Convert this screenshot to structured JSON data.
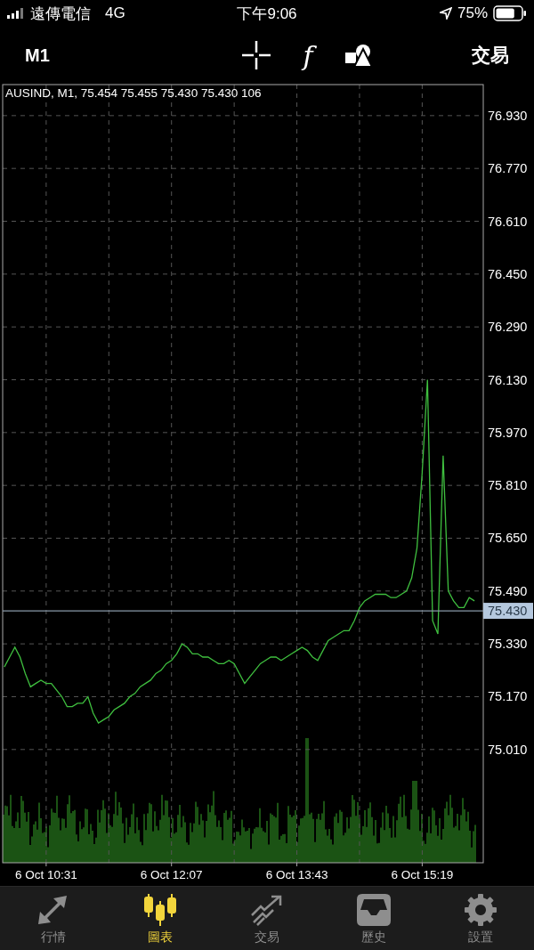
{
  "status_bar": {
    "carrier": "遠傳電信",
    "network": "4G",
    "time": "下午9:06",
    "battery": "75%"
  },
  "toolbar": {
    "timeframe": "M1",
    "indicator_symbol": "f",
    "action": "交易"
  },
  "chart": {
    "header": "AUSIND, M1, 75.454 75.455 75.430 75.430 106",
    "chart_data": {
      "type": "line",
      "categories": [
        null,
        null,
        null,
        null,
        null,
        null,
        null,
        null,
        "6 Oct 10:31",
        null,
        null,
        null,
        null,
        null,
        null,
        null,
        null,
        null,
        null,
        null,
        null,
        null,
        null,
        null,
        null,
        null,
        null,
        null,
        null,
        null,
        null,
        null,
        "6 Oct 12:07",
        null,
        null,
        null,
        null,
        null,
        null,
        null,
        null,
        null,
        null,
        null,
        null,
        null,
        null,
        null,
        null,
        null,
        null,
        null,
        null,
        null,
        null,
        null,
        "6 Oct 13:43",
        null,
        null,
        null,
        null,
        null,
        null,
        null,
        null,
        null,
        null,
        null,
        null,
        null,
        null,
        null,
        null,
        null,
        null,
        null,
        null,
        null,
        null,
        null,
        "6 Oct 15:19",
        null,
        null,
        null,
        null,
        null,
        null,
        null,
        null,
        null,
        null
      ],
      "series": [
        {
          "color": "#3fbf3f",
          "values": [
            75.26,
            75.29,
            75.32,
            75.29,
            75.24,
            75.2,
            75.21,
            75.22,
            75.21,
            75.21,
            75.19,
            75.17,
            75.14,
            75.14,
            75.15,
            75.15,
            75.17,
            75.12,
            75.09,
            75.1,
            75.11,
            75.13,
            75.14,
            75.15,
            75.17,
            75.18,
            75.2,
            75.21,
            75.22,
            75.24,
            75.25,
            75.27,
            75.28,
            75.3,
            75.33,
            75.32,
            75.3,
            75.3,
            75.29,
            75.29,
            75.28,
            75.27,
            75.27,
            75.28,
            75.27,
            75.24,
            75.21,
            75.23,
            75.25,
            75.27,
            75.28,
            75.29,
            75.29,
            75.28,
            75.29,
            75.3,
            75.31,
            75.32,
            75.31,
            75.29,
            75.28,
            75.31,
            75.34,
            75.35,
            75.36,
            75.37,
            75.37,
            75.4,
            75.44,
            75.46,
            75.47,
            75.48,
            75.48,
            75.48,
            75.47,
            75.47,
            75.48,
            75.49,
            75.53,
            75.62,
            75.85,
            76.13,
            75.4,
            75.36,
            75.9,
            75.49,
            75.46,
            75.44,
            75.44,
            75.47,
            75.46
          ]
        }
      ],
      "ylim": [
        74.667,
        77.024
      ],
      "grid": true,
      "yticks": [
        {
          "value": 76.93,
          "label": "76.930"
        },
        {
          "value": 76.77,
          "label": "76.770"
        },
        {
          "value": 76.61,
          "label": "76.610"
        },
        {
          "value": 76.45,
          "label": "76.450"
        },
        {
          "value": 76.29,
          "label": "76.290"
        },
        {
          "value": 76.13,
          "label": "76.130"
        },
        {
          "value": 75.97,
          "label": "75.970"
        },
        {
          "value": 75.81,
          "label": "75.810"
        },
        {
          "value": 75.65,
          "label": "75.650"
        },
        {
          "value": 75.49,
          "label": "75.490"
        },
        {
          "value": 75.33,
          "label": "75.330"
        },
        {
          "value": 75.17,
          "label": "75.170"
        },
        {
          "value": 75.01,
          "label": "75.010"
        }
      ],
      "ref_lines": [
        {
          "axis": "y",
          "value": 75.43,
          "label": "75.430",
          "color": "#8a9aaa"
        }
      ]
    }
  },
  "tabs": [
    {
      "label": "行情",
      "selected": false
    },
    {
      "label": "圖表",
      "selected": true
    },
    {
      "label": "交易",
      "selected": false
    },
    {
      "label": "歷史",
      "selected": false
    },
    {
      "label": "設置",
      "selected": false
    }
  ]
}
